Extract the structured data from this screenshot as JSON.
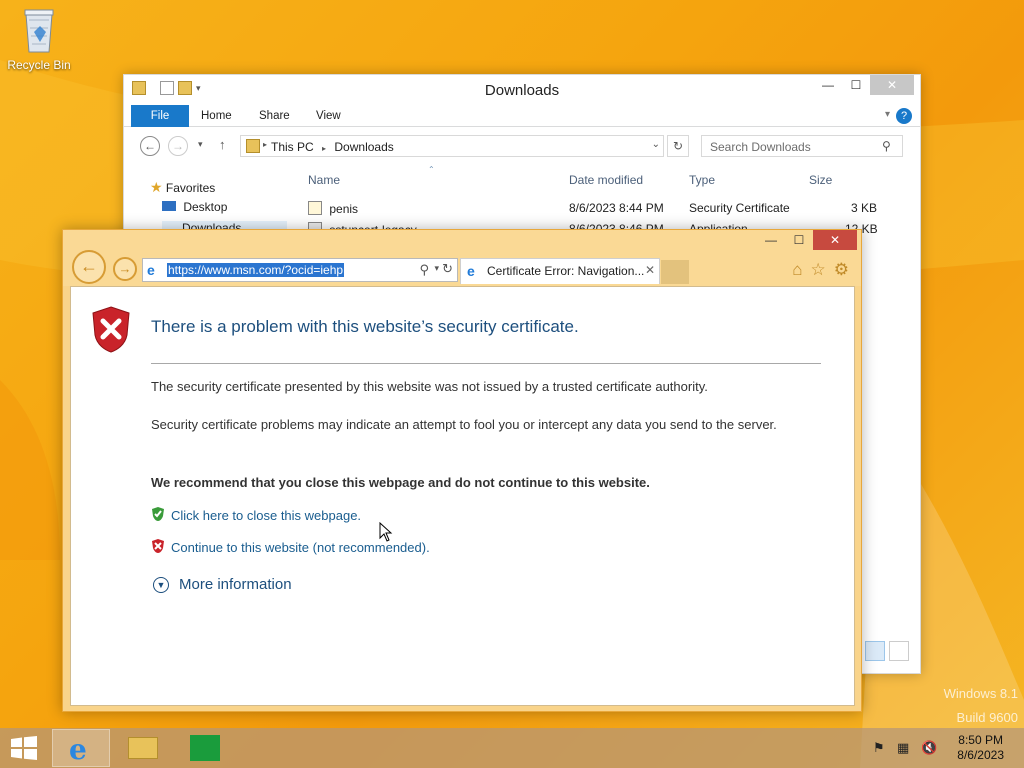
{
  "desktop": {
    "recycle_bin_label": "Recycle Bin",
    "watermark_line1": "Windows 8.1",
    "watermark_line2": "Build 9600"
  },
  "explorer": {
    "title": "Downloads",
    "ribbon_tabs": [
      "File",
      "Home",
      "Share",
      "View"
    ],
    "address_crumbs": [
      "This PC",
      "Downloads"
    ],
    "search_placeholder": "Search Downloads",
    "columns": [
      "Name",
      "Date modified",
      "Type",
      "Size"
    ],
    "nav_pane": [
      "Favorites",
      "Desktop",
      "Downloads"
    ],
    "files": [
      {
        "name": "penis",
        "date": "8/6/2023 8:44 PM",
        "type": "Security Certificate",
        "size": "3 KB"
      },
      {
        "name": "sstuncert-legacy",
        "date": "8/6/2023 8:46 PM",
        "type": "Application",
        "size": "12 KB"
      }
    ]
  },
  "ie": {
    "url": "https://www.msn.com/?ocid=iehp",
    "tab_title": "Certificate Error: Navigation...",
    "page": {
      "heading": "There is a problem with this website’s security certificate.",
      "para1": "The security certificate presented by this website was not issued by a trusted certificate authority.",
      "para2": "Security certificate problems may indicate an attempt to fool you or intercept any data you send to the server.",
      "recommendation": "We recommend that you close this webpage and do not continue to this website.",
      "close_link": "Click here to close this webpage.",
      "continue_link": "Continue to this website (not recommended).",
      "more_info": "More information"
    }
  },
  "taskbar": {
    "time": "8:50 PM",
    "date": "8/6/2023"
  },
  "colors": {
    "accent_ie": "#e8a73a",
    "explorer_file_tab": "#1979ca",
    "link": "#1a5d8f",
    "heading": "#1d4f7e"
  }
}
